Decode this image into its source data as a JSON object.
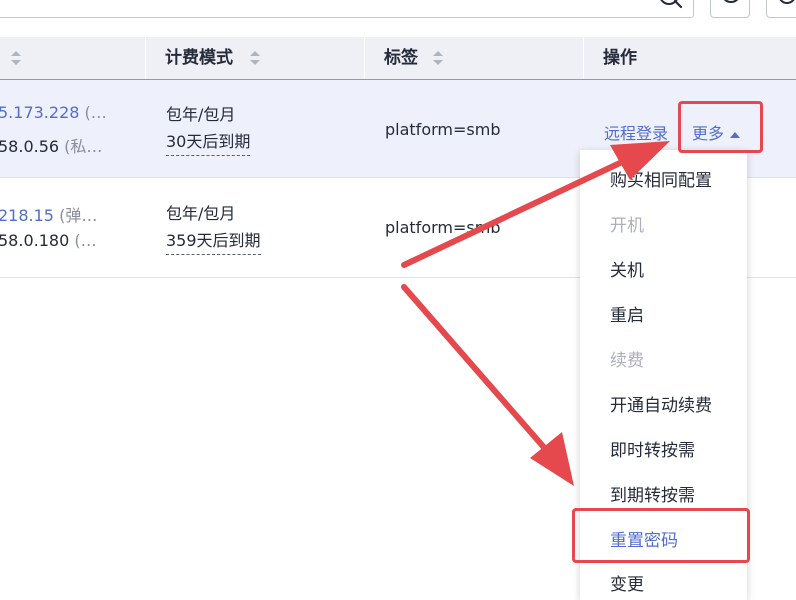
{
  "header": {
    "columns": [
      {
        "label": ""
      },
      {
        "label": "计费模式"
      },
      {
        "label": "标签"
      },
      {
        "label": "操作"
      }
    ]
  },
  "rows": [
    {
      "ip_public": "5.173.228",
      "ip_public_suffix": "(…",
      "ip_private": "58.0.56",
      "ip_private_suffix": "(私…",
      "billing_mode": "包年/包月",
      "expire": "30天后到期",
      "tag": "platform=smb",
      "action_remote": "远程登录",
      "action_more": "更多"
    },
    {
      "ip_public": "218.15",
      "ip_public_suffix": "(弹…",
      "ip_private": "58.0.180",
      "ip_private_suffix": "(…",
      "billing_mode": "包年/包月",
      "expire": "359天后到期",
      "tag": "platform=smb"
    }
  ],
  "dropdown": {
    "items": [
      {
        "label": "购买相同配置",
        "disabled": false
      },
      {
        "label": "开机",
        "disabled": true
      },
      {
        "label": "关机",
        "disabled": false
      },
      {
        "label": "重启",
        "disabled": false
      },
      {
        "label": "续费",
        "disabled": true
      },
      {
        "label": "开通自动续费",
        "disabled": false
      },
      {
        "label": "即时转按需",
        "disabled": false
      },
      {
        "label": "到期转按需",
        "disabled": false
      },
      {
        "label": "重置密码",
        "disabled": false,
        "highlighted": true
      },
      {
        "label": "变更",
        "disabled": false
      }
    ]
  },
  "colors": {
    "link": "#526ecc",
    "annotation_red": "#e5484d",
    "header_bg": "#eef0f5",
    "selected_row_bg": "#eef1fb"
  },
  "icons": [
    "search-icon",
    "refresh-icon",
    "settings-icon",
    "sort-icon",
    "caret-up-icon"
  ]
}
